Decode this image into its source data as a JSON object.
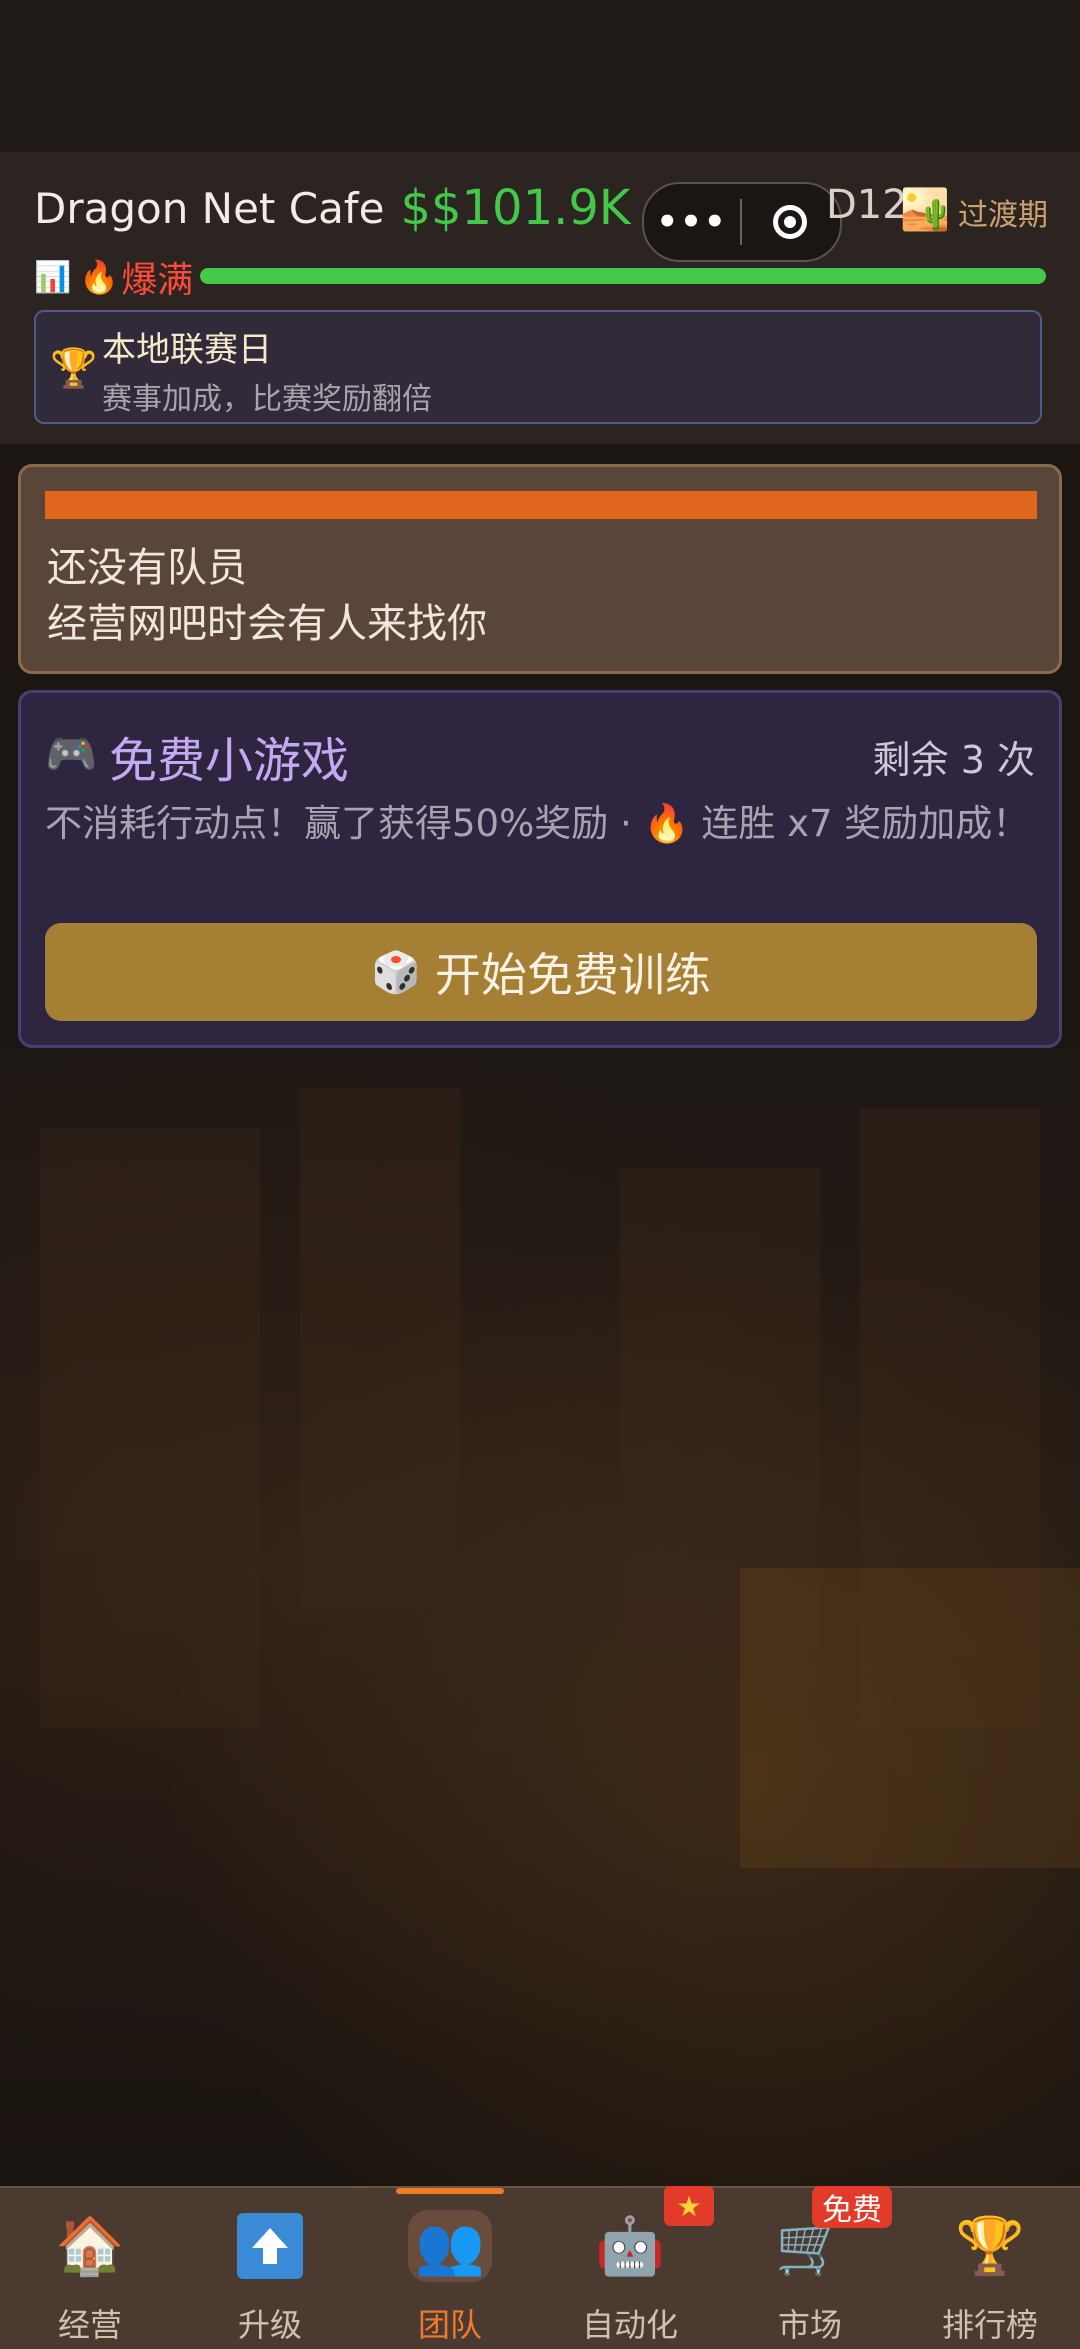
{
  "header": {
    "cafe_name": "Dragon Net Cafe",
    "money": "$$101.9K",
    "caret_icon": "▼",
    "day": "D12",
    "season_icon": "🏜️",
    "season": "过渡期",
    "crowd_chart_icon": "📊",
    "crowd_fire_icon": "🔥",
    "crowd_status": "爆满",
    "crowd_level": 1.0
  },
  "miniprogram_capsule": {
    "menu_icon": "•••"
  },
  "event": {
    "icon": "🏆",
    "title": "本地联赛日",
    "description": "赛事加成，比赛奖励翻倍"
  },
  "team": {
    "line1": "还没有队员",
    "line2": "经营网吧时会有人来找你"
  },
  "mini_game": {
    "icon": "🎮",
    "title": "免费小游戏",
    "remaining": "剩余 3 次",
    "description": "不消耗行动点！赢了获得50%奖励 · 🔥 连胜 x7 奖励加成！",
    "button_icon": "🎲",
    "button_label": "开始免费训练"
  },
  "nav": {
    "items": [
      {
        "label": "经营",
        "icon": "🏠"
      },
      {
        "label": "升级",
        "icon": "⬆"
      },
      {
        "label": "团队",
        "icon": "👥"
      },
      {
        "label": "自动化",
        "icon": "🤖",
        "badge": "★"
      },
      {
        "label": "市场",
        "icon": "🛒",
        "badge": "免费"
      },
      {
        "label": "排行榜",
        "icon": "🏆"
      }
    ],
    "active": "团队"
  },
  "colors": {
    "money": "#43c84a",
    "crowd": "#ff4a3a",
    "accent": "#f07a2c",
    "button": "#a57f33"
  }
}
